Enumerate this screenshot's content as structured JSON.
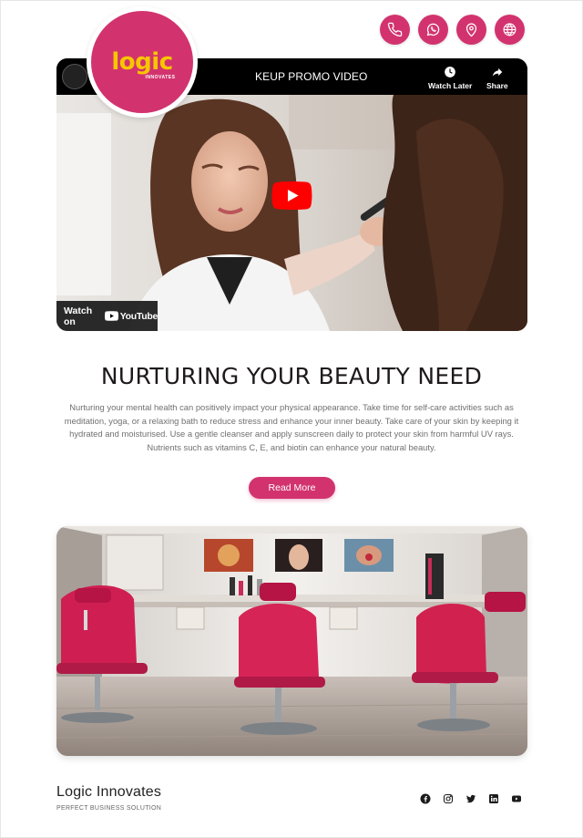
{
  "colors": {
    "accent": "#d2336e",
    "logo_text": "#f7c600",
    "dark": "#1e1a1c"
  },
  "header": {
    "contact_icons": [
      "phone-icon",
      "whatsapp-icon",
      "location-pin-icon",
      "globe-icon"
    ]
  },
  "logo": {
    "word": "logic",
    "sub": "INNOVATES"
  },
  "video": {
    "title": "KEUP PROMO VIDEO",
    "watch_later": "Watch Later",
    "share": "Share",
    "watch_on": "Watch on",
    "youtube": "YouTube"
  },
  "main": {
    "headline": "NURTURING YOUR BEAUTY NEED",
    "paragraph": "Nurturing your mental health can positively impact your physical appearance. Take time for self-care activities such as meditation, yoga, or a relaxing bath to reduce stress and enhance your inner beauty. Take care of your skin by keeping it hydrated and moisturised. Use a gentle cleanser and apply sunscreen daily to protect your skin from harmful UV rays. Nutrients such as vitamins C, E, and biotin can enhance your natural beauty.",
    "read_more": "Read More"
  },
  "footer": {
    "brand": "Logic Innovates",
    "tagline": "PERFECT BUSINESS SOLUTION",
    "social_icons": [
      "facebook-icon",
      "instagram-icon",
      "twitter-icon",
      "linkedin-icon",
      "youtube-icon"
    ]
  }
}
